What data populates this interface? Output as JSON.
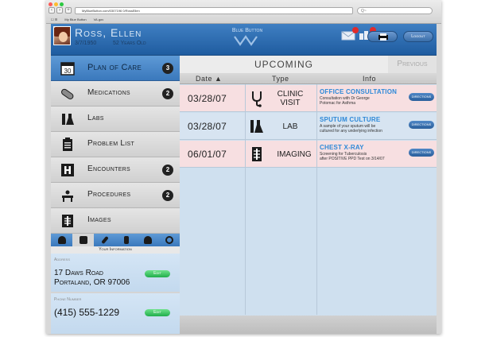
{
  "browser": {
    "url": "MyBlueButton.com/0307196 0/RossEllen",
    "search_placeholder": "Q~",
    "bookmarks": [
      "My Blue Button",
      "VA.gov"
    ]
  },
  "patient": {
    "name": "Ross, Ellen",
    "dob": "3/7/1950",
    "age": "52 Years Old"
  },
  "header": {
    "brand": "Blue Button",
    "mail_badge": "",
    "alerts_badge": "",
    "logout_label": "Logout"
  },
  "sidebar": {
    "items": [
      {
        "label": "Plan of Care",
        "count": "3",
        "icon": "calendar-icon",
        "active": true
      },
      {
        "label": "Medications",
        "count": "2",
        "icon": "pill-icon"
      },
      {
        "label": "Labs",
        "count": "",
        "icon": "flask-icon"
      },
      {
        "label": "Problem List",
        "count": "",
        "icon": "clipboard-icon"
      },
      {
        "label": "Encounters",
        "count": "2",
        "icon": "hospital-icon"
      },
      {
        "label": "Procedures",
        "count": "2",
        "icon": "procedure-icon"
      },
      {
        "label": "Images",
        "count": "",
        "icon": "xray-icon"
      }
    ],
    "tools": [
      "person-icon",
      "id-card-icon",
      "syringe-icon",
      "bottle-icon",
      "group-icon",
      "no-icon"
    ],
    "info_title": "Your Information",
    "address_caption": "Address",
    "address_line1": "17 Daws Road",
    "address_line2": "Portaland, OR 97006",
    "phone_caption": "Phone Number",
    "phone": "(415) 555-1229",
    "edit_label": "Edit"
  },
  "main": {
    "upcoming_label": "Upcoming",
    "previous_label": "Previous",
    "columns": [
      "Date ▲",
      "Type",
      "Info"
    ],
    "appointments": [
      {
        "date": "03/28/07",
        "type_line1": "Clinic",
        "type_line2": "Visit",
        "icon": "stethoscope-icon",
        "title": "Office Consultation",
        "desc_line1": "Consultation with Dr George",
        "desc_line2": "Potomac for Asthma",
        "directions": "Directions",
        "color": "#f7dfe1"
      },
      {
        "date": "03/28/07",
        "type_line1": "Lab",
        "type_line2": "",
        "icon": "flask-icon",
        "title": "Sputum Culture",
        "desc_line1": "A sample of your sputum will be",
        "desc_line2": "cultured for any underlying infection",
        "directions": "Directions",
        "color": "#d7e4f1"
      },
      {
        "date": "06/01/07",
        "type_line1": "Imaging",
        "type_line2": "",
        "icon": "xray-icon",
        "title": "Chest X-Ray",
        "desc_line1": "Screening for Tuberculosis",
        "desc_line2": "after POSITIVE PPD Test on 3/14/07",
        "directions": "Directions",
        "color": "#f7dfe1"
      }
    ]
  },
  "colors": {
    "header_blue": "#2a6aae",
    "active_blue": "#4a88c9",
    "title_blue": "#2e89d8",
    "edit_green": "#2dbb55",
    "badge_red": "#e12b2b"
  }
}
